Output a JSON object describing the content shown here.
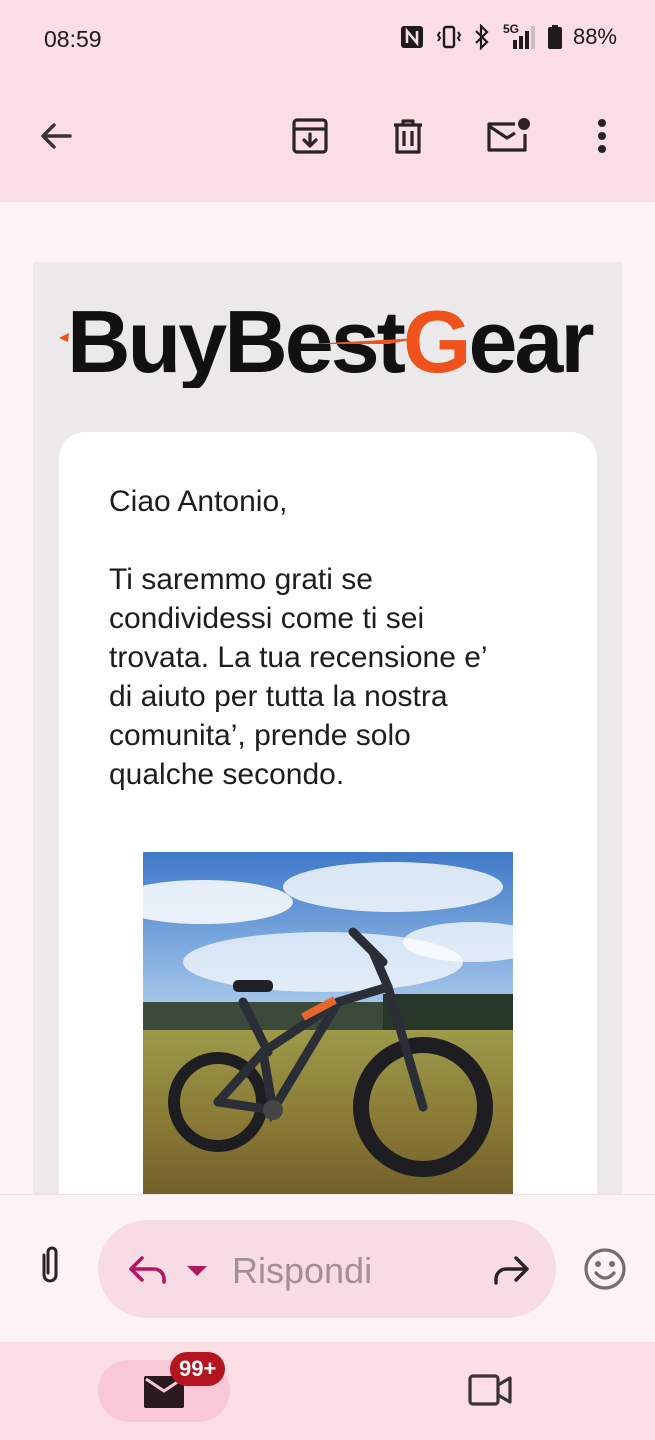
{
  "status_bar": {
    "time": "08:59",
    "network": "5G",
    "battery": "88%",
    "icons": [
      "nfc-icon",
      "vibrate-icon",
      "bluetooth-icon",
      "signal-icon",
      "battery-icon"
    ]
  },
  "toolbar": {
    "back_icon": "arrow-left-icon",
    "archive_icon": "archive-icon",
    "delete_icon": "trash-icon",
    "mark_unread_icon": "mail-unread-icon",
    "more_icon": "more-vert-icon"
  },
  "email": {
    "brand": "BuyBestGear",
    "brand_parts": [
      "BuyBest",
      "G",
      "ear"
    ],
    "greeting": "Ciao Antonio,",
    "body": "Ti saremmo grati se condividessi come ti sei trovata. La tua recensione e’ di aiuto per tutta la nostra comunita’, prende solo qualche secondo.",
    "body_lines": [
      "Ti saremmo grati se",
      "condividessi come ti sei",
      "trovata. La tua recensione e’",
      "di aiuto per tutta la nostra",
      "comunita’, prende solo",
      "qualche secondo."
    ],
    "image": "photo-of-electric-fat-tire-bike-in-field"
  },
  "reply_bar": {
    "placeholder": "Rispondi",
    "attach_icon": "paperclip-icon",
    "reply_icon": "reply-icon",
    "forward_icon": "forward-icon",
    "emoji_icon": "emoji-icon"
  },
  "bottom_nav": {
    "mail_badge": "99+",
    "mail_icon": "mail-icon",
    "meet_icon": "video-camera-icon"
  },
  "colors": {
    "accent": "#b5175e",
    "brand_orange": "#f0521c",
    "header_bg": "#fbdde4",
    "reply_pill": "#f8dce5",
    "badge": "#b3141f"
  }
}
